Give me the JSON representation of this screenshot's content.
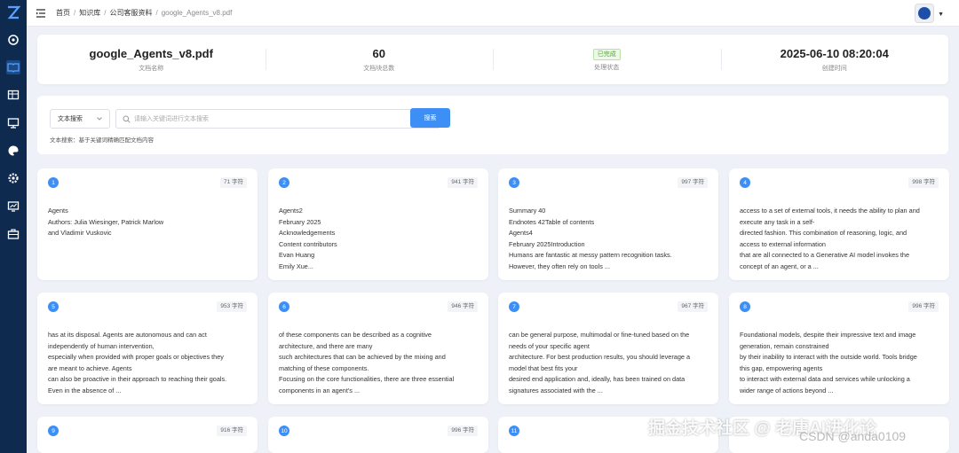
{
  "breadcrumb": [
    "首页",
    "知识库",
    "公司客服资料",
    "google_Agents_v8.pdf"
  ],
  "stats": {
    "doc_name": "google_Agents_v8.pdf",
    "doc_name_label": "文档名称",
    "chunk_count": "60",
    "chunk_count_label": "文档块总数",
    "status": "已完成",
    "status_label": "处理状态",
    "created": "2025-06-10 08:20:04",
    "created_label": "创建时间"
  },
  "search": {
    "type_value": "文本搜索",
    "placeholder": "请输入关键词进行文本搜索",
    "button": "搜索",
    "hint": "文本搜索：基于关键词精确匹配文档内容"
  },
  "chunks": [
    {
      "num": "1",
      "chars": "71 字符",
      "text": "Agents\nAuthors: Julia Wiesinger, Patrick Marlow\nand Vladimir Vuskovic"
    },
    {
      "num": "2",
      "chars": "941 字符",
      "text": "Agents2\nFebruary 2025\nAcknowledgements\nContent contributors\nEvan Huang\nEmily Xue..."
    },
    {
      "num": "3",
      "chars": "997 字符",
      "text": "Summary  40\nEndnotes  42Table of contents\nAgents4\nFebruary 2025Introduction\nHumans are fantastic at messy pattern recognition tasks.\nHowever, they often rely on tools ..."
    },
    {
      "num": "4",
      "chars": "998 字符",
      "text": "access to a set of external tools, it needs the ability to plan and\nexecute any task in a self-\ndirected fashion. This combination of reasoning, logic, and\naccess to external information\nthat are all connected to a Generative AI model invokes the\nconcept of an agent, or a ..."
    },
    {
      "num": "5",
      "chars": "953 字符",
      "text": "has at its disposal. Agents are autonomous and can act\nindependently of human intervention,\nespecially when provided with proper goals or objectives they\nare meant to achieve. Agents\ncan also be proactive in their approach to reaching their goals.\nEven in the absence of ..."
    },
    {
      "num": "6",
      "chars": "946 字符",
      "text": "of these components can be described as a cognitive\narchitecture, and there are many\nsuch architectures that can be achieved by the mixing and\nmatching of these components.\nFocusing on the core functionalities, there are three essential\ncomponents in an agent's ..."
    },
    {
      "num": "7",
      "chars": "967 字符",
      "text": "can be general purpose, multimodal or fine-tuned based on the\nneeds of your specific agent\narchitecture. For best production results, you should leverage a\nmodel that best fits your\ndesired end application and, ideally, has been trained on data\nsignatures associated with the ..."
    },
    {
      "num": "8",
      "chars": "996 字符",
      "text": "Foundational models, despite their impressive text and image\ngeneration, remain constrained\nby their inability to interact with the outside world. Tools  bridge\nthis gap, empowering agents\nto interact with external data and services while unlocking a\nwider range of actions beyond ..."
    },
    {
      "num": "9",
      "chars": "916 字符",
      "text": ""
    },
    {
      "num": "10",
      "chars": "996 字符",
      "text": ""
    },
    {
      "num": "11",
      "chars": "",
      "text": ""
    },
    {
      "num": "",
      "chars": "",
      "text": ""
    }
  ],
  "watermark": "掘金技术社区 @ 老唐AI进化论",
  "watermark2": "CSDN @anda0109"
}
